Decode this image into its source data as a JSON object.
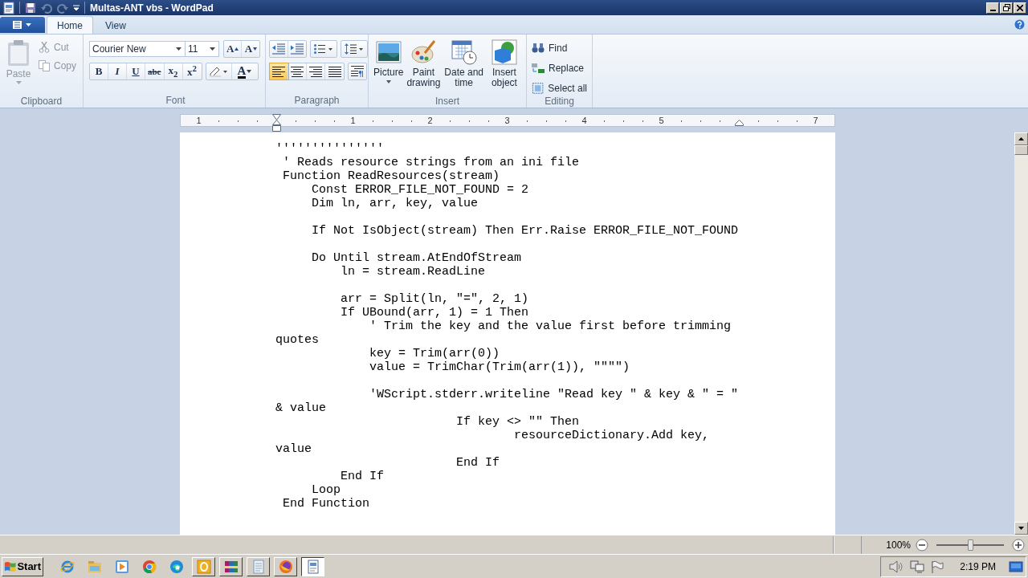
{
  "window": {
    "title": "Multas-ANT vbs - WordPad"
  },
  "ribbon_tabs": [
    {
      "label": "Home",
      "selected": true
    },
    {
      "label": "View",
      "selected": false
    }
  ],
  "clipboard": {
    "label": "Clipboard",
    "paste": {
      "label": "Paste",
      "disabled": true
    },
    "cut": {
      "label": "Cut",
      "disabled": true
    },
    "copy": {
      "label": "Copy",
      "disabled": true
    }
  },
  "font": {
    "label": "Font",
    "family": "Courier New",
    "size": "11",
    "grow": "A",
    "shrink": "A",
    "formats": [
      {
        "kind": "bold",
        "label": "B"
      },
      {
        "kind": "italic",
        "label": "I"
      },
      {
        "kind": "underline",
        "label": "U"
      },
      {
        "kind": "strike",
        "label": "abc"
      },
      {
        "kind": "sub",
        "label": "x$_{2}$"
      },
      {
        "kind": "sup",
        "label": "x$^{2}$"
      }
    ],
    "font_color_label": "A"
  },
  "paragraph": {
    "label": "Paragraph",
    "alignment": [
      {
        "kind": "left",
        "selected": true
      },
      {
        "kind": "center",
        "selected": false
      },
      {
        "kind": "right",
        "selected": false
      },
      {
        "kind": "justify",
        "selected": false
      }
    ]
  },
  "insert": {
    "label": "Insert",
    "items": [
      {
        "kind": "picture",
        "label": "Picture"
      },
      {
        "kind": "paint",
        "label": "Paint drawing"
      },
      {
        "kind": "datetime",
        "label": "Date and time"
      },
      {
        "kind": "object",
        "label": "Insert object"
      }
    ]
  },
  "editing": {
    "label": "Editing",
    "items": [
      {
        "kind": "find",
        "label": "Find"
      },
      {
        "kind": "replace",
        "label": "Replace"
      },
      {
        "kind": "select_all",
        "label": "Select all"
      }
    ]
  },
  "ruler": {
    "labels": [
      "1",
      "1",
      "2",
      "3",
      "4",
      "5",
      "7"
    ]
  },
  "document": {
    "lines": [
      {
        "text": "'''''''''''''''"
      },
      {
        "text": " ' Reads resource strings from an ini file"
      },
      {
        "text": " Function ReadResources(stream)"
      },
      {
        "text": "     Const ERROR_FILE_NOT_FOUND = 2"
      },
      {
        "text": "     Dim ln, arr, key, value"
      },
      {
        "kind": "blank"
      },
      {
        "text": "     If Not IsObject(stream) Then Err.Raise ERROR_FILE_NOT_FOUND"
      },
      {
        "kind": "blank"
      },
      {
        "text": "     Do Until stream.AtEndOfStream"
      },
      {
        "text": "         ln = stream.ReadLine"
      },
      {
        "kind": "blank"
      },
      {
        "text": "         arr = Split(ln, \"=\", 2, 1)"
      },
      {
        "text": "         If UBound(arr, 1) = 1 Then"
      },
      {
        "text": "             ' Trim the key and the value first before trimming"
      },
      {
        "text": "quotes"
      },
      {
        "text": "             key = Trim(arr(0))"
      },
      {
        "text": "             value = TrimChar(Trim(arr(1)), \"\"\"\")"
      },
      {
        "kind": "blank"
      },
      {
        "text": "             'WScript.stderr.writeline \"Read key \" & key & \" = \""
      },
      {
        "text": "& value"
      },
      {
        "text": "                         If key <> \"\" Then"
      },
      {
        "text": "                                 resourceDictionary.Add key,"
      },
      {
        "text": "value"
      },
      {
        "text": "                         End If"
      },
      {
        "text": "         End If"
      },
      {
        "text": "     Loop"
      },
      {
        "text": " End Function"
      }
    ]
  },
  "status_bar": {
    "zoom": "100%",
    "zoom_slider": {
      "level": 0.5
    }
  },
  "taskbar": {
    "start": "Start",
    "apps": [
      {
        "kind": "ie",
        "running": false,
        "selected": false
      },
      {
        "kind": "explorer",
        "running": false,
        "selected": false
      },
      {
        "kind": "media",
        "running": false,
        "selected": false
      },
      {
        "kind": "chrome",
        "running": false,
        "selected": false
      },
      {
        "kind": "edge",
        "running": false,
        "selected": false
      },
      {
        "kind": "outlook",
        "running": true,
        "selected": false
      },
      {
        "kind": "winrar",
        "running": true,
        "selected": false
      },
      {
        "kind": "notepad",
        "running": true,
        "selected": false
      },
      {
        "kind": "firefox",
        "running": true,
        "selected": false
      },
      {
        "kind": "wordpad",
        "running": true,
        "selected": true
      }
    ],
    "clock": "2:19 PM"
  }
}
